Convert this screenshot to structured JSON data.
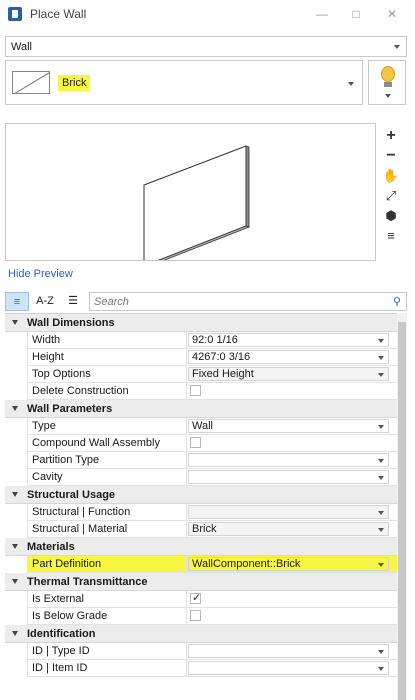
{
  "window": {
    "title": "Place Wall"
  },
  "element_type": {
    "selected": "Wall"
  },
  "type_picker": {
    "selected": "Brick"
  },
  "preview": {
    "hide_label": "Hide Preview",
    "zoom_in": "+",
    "zoom_out": "−"
  },
  "property_toolbar": {
    "az_label": "A-Z",
    "search_placeholder": "Search"
  },
  "categories": [
    {
      "label": "Wall Dimensions"
    },
    {
      "label": "Wall Parameters"
    },
    {
      "label": "Structural Usage"
    },
    {
      "label": "Materials"
    },
    {
      "label": "Thermal Transmittance"
    },
    {
      "label": "Identification"
    }
  ],
  "rows": {
    "width": {
      "label": "Width",
      "value": "92:0 1/16"
    },
    "height": {
      "label": "Height",
      "value": "4267:0 3/16"
    },
    "top_options": {
      "label": "Top Options",
      "value": "Fixed Height"
    },
    "delete_construction": {
      "label": "Delete Construction",
      "checked": false
    },
    "type": {
      "label": "Type",
      "value": "Wall"
    },
    "compound": {
      "label": "Compound Wall Assembly",
      "checked": false
    },
    "partition_type": {
      "label": "Partition Type",
      "value": ""
    },
    "cavity": {
      "label": "Cavity",
      "value": ""
    },
    "structural_function": {
      "label": "Structural | Function",
      "value": ""
    },
    "structural_material": {
      "label": "Structural | Material",
      "value": "Brick"
    },
    "part_definition": {
      "label": "Part Definition",
      "value": "WallComponent::Brick"
    },
    "is_external": {
      "label": "Is External",
      "checked": true
    },
    "is_below_grade": {
      "label": "Is Below Grade",
      "checked": false
    },
    "id_type": {
      "label": "ID | Type ID",
      "value": ""
    },
    "id_item": {
      "label": "ID | Item ID",
      "value": ""
    }
  },
  "colors": {
    "highlight": "#f7f740",
    "link": "#2a66c4",
    "accent": "#2b5ea8"
  }
}
